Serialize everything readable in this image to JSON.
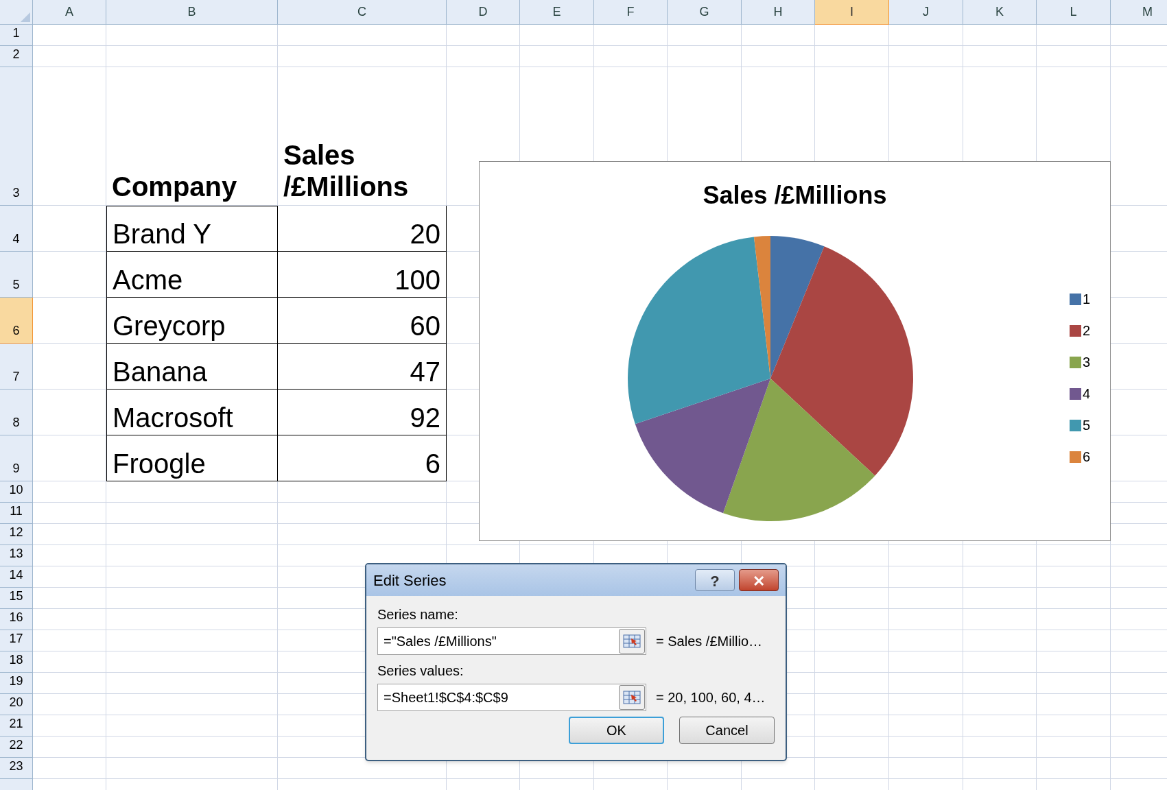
{
  "sheet": {
    "columns": [
      {
        "label": "A",
        "selected": false
      },
      {
        "label": "B",
        "selected": false
      },
      {
        "label": "C",
        "selected": false
      },
      {
        "label": "D",
        "selected": false
      },
      {
        "label": "E",
        "selected": false
      },
      {
        "label": "F",
        "selected": false
      },
      {
        "label": "G",
        "selected": false
      },
      {
        "label": "H",
        "selected": false
      },
      {
        "label": "I",
        "selected": true
      },
      {
        "label": "J",
        "selected": false
      },
      {
        "label": "K",
        "selected": false
      },
      {
        "label": "L",
        "selected": false
      },
      {
        "label": "M",
        "selected": false
      }
    ],
    "rows": [
      {
        "label": "1",
        "selected": false
      },
      {
        "label": "2",
        "selected": false
      },
      {
        "label": "3",
        "selected": false
      },
      {
        "label": "4",
        "selected": false
      },
      {
        "label": "5",
        "selected": false
      },
      {
        "label": "6",
        "selected": true
      },
      {
        "label": "7",
        "selected": false
      },
      {
        "label": "8",
        "selected": false
      },
      {
        "label": "9",
        "selected": false
      },
      {
        "label": "10",
        "selected": false
      },
      {
        "label": "11",
        "selected": false
      },
      {
        "label": "12",
        "selected": false
      },
      {
        "label": "13",
        "selected": false
      },
      {
        "label": "14",
        "selected": false
      },
      {
        "label": "15",
        "selected": false
      },
      {
        "label": "16",
        "selected": false
      },
      {
        "label": "17",
        "selected": false
      },
      {
        "label": "18",
        "selected": false
      },
      {
        "label": "19",
        "selected": false
      },
      {
        "label": "20",
        "selected": false
      },
      {
        "label": "21",
        "selected": false
      },
      {
        "label": "22",
        "selected": false
      },
      {
        "label": "23",
        "selected": false
      }
    ]
  },
  "table": {
    "header": [
      "Company",
      "Sales\n/£Millions"
    ],
    "rows": [
      [
        "Brand Y",
        "20"
      ],
      [
        "Acme",
        "100"
      ],
      [
        "Greycorp",
        "60"
      ],
      [
        "Banana",
        "47"
      ],
      [
        "Macrosoft",
        "92"
      ],
      [
        "Froogle",
        "6"
      ]
    ]
  },
  "chart": {
    "chart_data": {
      "type": "pie",
      "title": "Sales /£Millions",
      "categories": [
        "1",
        "2",
        "3",
        "4",
        "5",
        "6"
      ],
      "values": [
        20,
        100,
        60,
        47,
        92,
        6
      ],
      "legend": "right",
      "colors": [
        "#4572a7",
        "#aa4643",
        "#89a54e",
        "#71588f",
        "#4198af",
        "#db843d"
      ]
    }
  },
  "dialog": {
    "title": "Edit Series",
    "help": "?",
    "close": "✕",
    "fields": [
      {
        "label": "Series name:",
        "value": "=\"Sales /£Millions\"",
        "preview": "= Sales /£Millio…"
      },
      {
        "label": "Series values:",
        "value": "=Sheet1!$C$4:$C$9",
        "preview": "= 20, 100, 60, 4…"
      }
    ],
    "buttons": [
      {
        "label": "OK",
        "default": true
      },
      {
        "label": "Cancel",
        "default": false
      }
    ]
  }
}
